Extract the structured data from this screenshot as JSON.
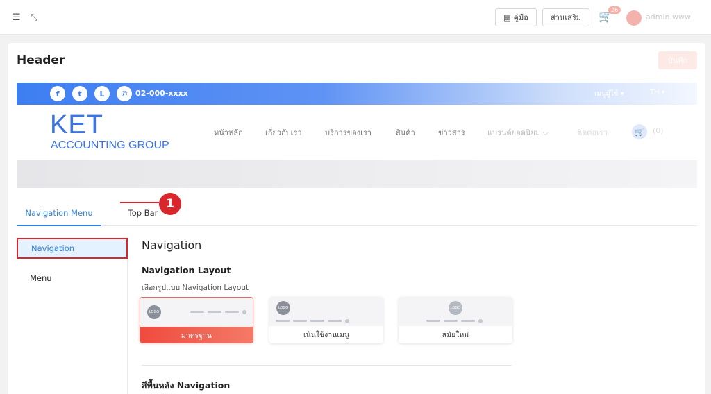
{
  "topbar": {
    "manual_label": "คู่มือ",
    "addons_label": "ส่วนเสริม",
    "cart_badge": "26",
    "admin_name": "admin.www"
  },
  "page": {
    "title": "Header",
    "save_label": "บันทึก"
  },
  "preview": {
    "phone": "02-000-xxxx",
    "user_menu": "เมนูผู้ใช้ ▾",
    "lang": "TH ▾",
    "logo_main": "KET",
    "logo_sub": "ACCOUNTING GROUP",
    "menu": [
      "หน้าหลัก",
      "เกี่ยวกับเรา",
      "บริการของเรา",
      "สินค้า",
      "ข่าวสาร",
      "แบรนด์ยอดนิยม ⌵",
      "ติดต่อเรา"
    ],
    "cart_count": "(0)"
  },
  "tabs": [
    "Navigation Menu",
    "Top Bar"
  ],
  "side_menu": [
    "Navigation",
    "Menu"
  ],
  "callout_number": "1",
  "content": {
    "section_title": "Navigation",
    "layout_title": "Navigation Layout",
    "layout_helper": "เลือกรูปแบบ Navigation Layout",
    "layouts": [
      {
        "label": "มาตรฐาน",
        "logo": "LOGO",
        "selected": true
      },
      {
        "label": "เน้นใช้งานเมนู",
        "logo": "LOGO",
        "selected": false
      },
      {
        "label": "สมัยใหม่",
        "logo": "LOGO",
        "selected": false
      }
    ],
    "bg_title": "สีพื้นหลัง Navigation"
  },
  "colors": {
    "accent_blue": "#2f7fe0",
    "accent_red": "#d9262c",
    "selected_gradient_start": "#ef4b3e",
    "preview_blue": "#3d7ef2"
  }
}
